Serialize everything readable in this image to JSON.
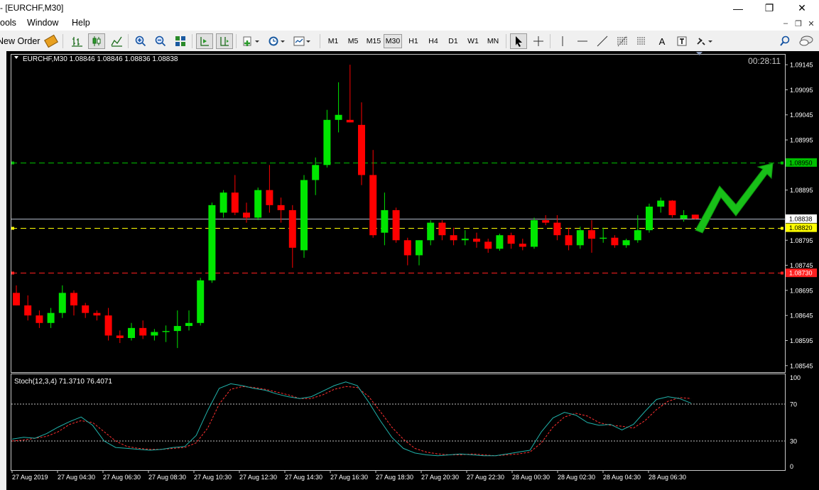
{
  "window": {
    "title": "- [EURCHF,M30]",
    "minimize_glyph": "—",
    "restore_glyph": "❐",
    "close_glyph": "✕"
  },
  "menu": {
    "items": [
      "ools",
      "Window",
      "Help"
    ],
    "mdi_minimize": "–",
    "mdi_restore": "❐",
    "mdi_close": "✕"
  },
  "toolbar": {
    "new_order_label": "New Order",
    "timeframes": [
      "M1",
      "M5",
      "M15",
      "M30",
      "H1",
      "H4",
      "D1",
      "W1",
      "MN"
    ],
    "active_timeframe": "M30",
    "text_tool_label": "A",
    "icons": [
      "pencil-icon",
      "bar-chart-icon",
      "candlestick-chart-icon",
      "line-chart-icon",
      "zoom-in-icon",
      "zoom-out-icon",
      "tile-windows-icon",
      "auto-scroll-icon",
      "chart-shift-icon",
      "indicators-icon",
      "periods-icon",
      "templates-icon",
      "cursor-icon",
      "crosshair-icon",
      "vertical-line-icon",
      "horizontal-line-icon",
      "trendline-icon",
      "fibonacci-icon",
      "fibonacci-fan-icon",
      "text-icon",
      "text-label-icon",
      "shapes-icon",
      "search-icon",
      "chat-icon"
    ]
  },
  "chart": {
    "symbol_info": "EURCHF,M30  1.08846 1.08846 1.08836 1.08838",
    "timer": "00:28:11",
    "indicator_label": "Stoch(12,3,4) 71.3710 76.4071",
    "colors": {
      "background": "#000000",
      "bull": "#00e600",
      "bear": "#ff0000",
      "grid_text": "#ffffff",
      "stoch_main": "#20b2aa",
      "stoch_signal": "#ff3030",
      "green_line": "#00c000",
      "yellow_line": "#ffff00",
      "red_line": "#ff2020",
      "bid_line": "#b0b8c8",
      "arrow": "#18c018"
    }
  },
  "chart_data": {
    "type": "candlestick",
    "symbol": "EURCHF",
    "timeframe": "M30",
    "price_axis_ticks": [
      "1.09145",
      "1.09095",
      "1.09045",
      "1.08995",
      "1.08895",
      "1.08795",
      "1.08745",
      "1.08695",
      "1.08645",
      "1.08595",
      "1.08545"
    ],
    "price_range": [
      1.08532,
      1.09165
    ],
    "levels": [
      {
        "label": "1.08950",
        "price": 1.0895,
        "color": "#00c000"
      },
      {
        "label": "1.08838",
        "price": 1.08838,
        "color": "#ffffff"
      },
      {
        "label": "1.08820",
        "price": 1.0882,
        "color": "#ffff00"
      },
      {
        "label": "1.08730",
        "price": 1.0873,
        "color": "#ff2020"
      }
    ],
    "time_labels": [
      "27 Aug 2019",
      "27 Aug 04:30",
      "27 Aug 06:30",
      "27 Aug 08:30",
      "27 Aug 10:30",
      "27 Aug 12:30",
      "27 Aug 14:30",
      "27 Aug 16:30",
      "27 Aug 18:30",
      "27 Aug 20:30",
      "27 Aug 22:30",
      "28 Aug 00:30",
      "28 Aug 02:30",
      "28 Aug 04:30",
      "28 Aug 06:30"
    ],
    "candles": [
      [
        1.0869,
        1.08705,
        1.08665,
        1.08665
      ],
      [
        1.08665,
        1.08685,
        1.08635,
        1.08645
      ],
      [
        1.08645,
        1.08655,
        1.0862,
        1.0863
      ],
      [
        1.0863,
        1.0866,
        1.0862,
        1.0865
      ],
      [
        1.0865,
        1.08705,
        1.0864,
        1.0869
      ],
      [
        1.0869,
        1.08695,
        1.08645,
        1.08665
      ],
      [
        1.08665,
        1.0867,
        1.0864,
        1.0865
      ],
      [
        1.0865,
        1.08655,
        1.08635,
        1.08645
      ],
      [
        1.08645,
        1.0866,
        1.08595,
        1.08605
      ],
      [
        1.08605,
        1.08615,
        1.0859,
        1.086
      ],
      [
        1.086,
        1.0863,
        1.08595,
        1.0862
      ],
      [
        1.0862,
        1.08635,
        1.08598,
        1.08605
      ],
      [
        1.08605,
        1.08618,
        1.08595,
        1.08612
      ],
      [
        1.08612,
        1.08625,
        1.08592,
        1.08614
      ],
      [
        1.08614,
        1.08655,
        1.0858,
        1.08624
      ],
      [
        1.08624,
        1.08655,
        1.08615,
        1.0863
      ],
      [
        1.0863,
        1.0872,
        1.08625,
        1.08715
      ],
      [
        1.08715,
        1.0887,
        1.0871,
        1.08865
      ],
      [
        1.0885,
        1.08895,
        1.0884,
        1.0889
      ],
      [
        1.0889,
        1.08925,
        1.08845,
        1.0885
      ],
      [
        1.0885,
        1.0887,
        1.0883,
        1.0884
      ],
      [
        1.0884,
        1.089,
        1.08835,
        1.08895
      ],
      [
        1.08895,
        1.08945,
        1.0885,
        1.08865
      ],
      [
        1.08865,
        1.0888,
        1.0883,
        1.08855
      ],
      [
        1.08855,
        1.08865,
        1.0874,
        1.0878
      ],
      [
        1.08775,
        1.08925,
        1.0876,
        1.08915
      ],
      [
        1.08915,
        1.0896,
        1.08885,
        1.08945
      ],
      [
        1.08945,
        1.09055,
        1.0894,
        1.09035
      ],
      [
        1.09035,
        1.0911,
        1.0901,
        1.09045
      ],
      [
        1.09035,
        1.09145,
        1.0903,
        1.0903
      ],
      [
        1.09025,
        1.0907,
        1.08905,
        1.08925
      ],
      [
        1.08925,
        1.08975,
        1.088,
        1.08805
      ],
      [
        1.0881,
        1.0889,
        1.08785,
        1.08855
      ],
      [
        1.08855,
        1.0886,
        1.0879,
        1.08795
      ],
      [
        1.08795,
        1.088,
        1.08745,
        1.08765
      ],
      [
        1.08765,
        1.08795,
        1.08745,
        1.08795
      ],
      [
        1.08795,
        1.08835,
        1.08785,
        1.0883
      ],
      [
        1.0883,
        1.08835,
        1.08795,
        1.08805
      ],
      [
        1.08805,
        1.0882,
        1.08785,
        1.08795
      ],
      [
        1.08795,
        1.08815,
        1.08785,
        1.08798
      ],
      [
        1.08798,
        1.0881,
        1.0878,
        1.08792
      ],
      [
        1.08792,
        1.08798,
        1.0877,
        1.08778
      ],
      [
        1.08778,
        1.08808,
        1.08774,
        1.08805
      ],
      [
        1.08805,
        1.0881,
        1.08778,
        1.08788
      ],
      [
        1.08788,
        1.08798,
        1.08775,
        1.08782
      ],
      [
        1.08782,
        1.0884,
        1.08778,
        1.08835
      ],
      [
        1.08835,
        1.08845,
        1.08825,
        1.0883
      ],
      [
        1.0883,
        1.08845,
        1.08795,
        1.08805
      ],
      [
        1.08805,
        1.0882,
        1.08775,
        1.08785
      ],
      [
        1.08785,
        1.08822,
        1.08778,
        1.08815
      ],
      [
        1.08815,
        1.08835,
        1.0877,
        1.08798
      ],
      [
        1.08798,
        1.0882,
        1.0879,
        1.088
      ],
      [
        1.088,
        1.08805,
        1.0878,
        1.08785
      ],
      [
        1.08785,
        1.08798,
        1.0878,
        1.08795
      ],
      [
        1.08795,
        1.08845,
        1.0879,
        1.08815
      ],
      [
        1.08815,
        1.08868,
        1.0881,
        1.08862
      ],
      [
        1.08862,
        1.0888,
        1.0885,
        1.08874
      ],
      [
        1.08874,
        1.08875,
        1.0884,
        1.08845
      ],
      [
        1.08838,
        1.08855,
        1.08832,
        1.08845
      ],
      [
        1.08846,
        1.08846,
        1.08836,
        1.08838
      ]
    ],
    "stoch_ticks": [
      "100",
      "70",
      "30",
      "0"
    ],
    "stoch_levels": [
      70,
      30
    ],
    "stoch_main": [
      32,
      34,
      33,
      38,
      45,
      51,
      56,
      47,
      30,
      23,
      22,
      21,
      20,
      21,
      23,
      24,
      36,
      63,
      87,
      92,
      90,
      87,
      85,
      81,
      78,
      76,
      78,
      84,
      90,
      94,
      90,
      72,
      52,
      34,
      22,
      17,
      15,
      14,
      15,
      16,
      15,
      14,
      14,
      16,
      18,
      20,
      40,
      55,
      61,
      58,
      50,
      47,
      48,
      42,
      48,
      62,
      75,
      78,
      76,
      71
    ],
    "stoch_signal": [
      30,
      31,
      33,
      35,
      40,
      48,
      52,
      50,
      40,
      30,
      24,
      22,
      21,
      21,
      22,
      23,
      28,
      44,
      70,
      86,
      89,
      88,
      86,
      83,
      80,
      76,
      76,
      80,
      86,
      89,
      88,
      78,
      62,
      45,
      32,
      22,
      18,
      16,
      15,
      15,
      16,
      15,
      14,
      15,
      16,
      18,
      28,
      45,
      56,
      60,
      57,
      50,
      47,
      46,
      44,
      52,
      64,
      73,
      77,
      76
    ]
  }
}
